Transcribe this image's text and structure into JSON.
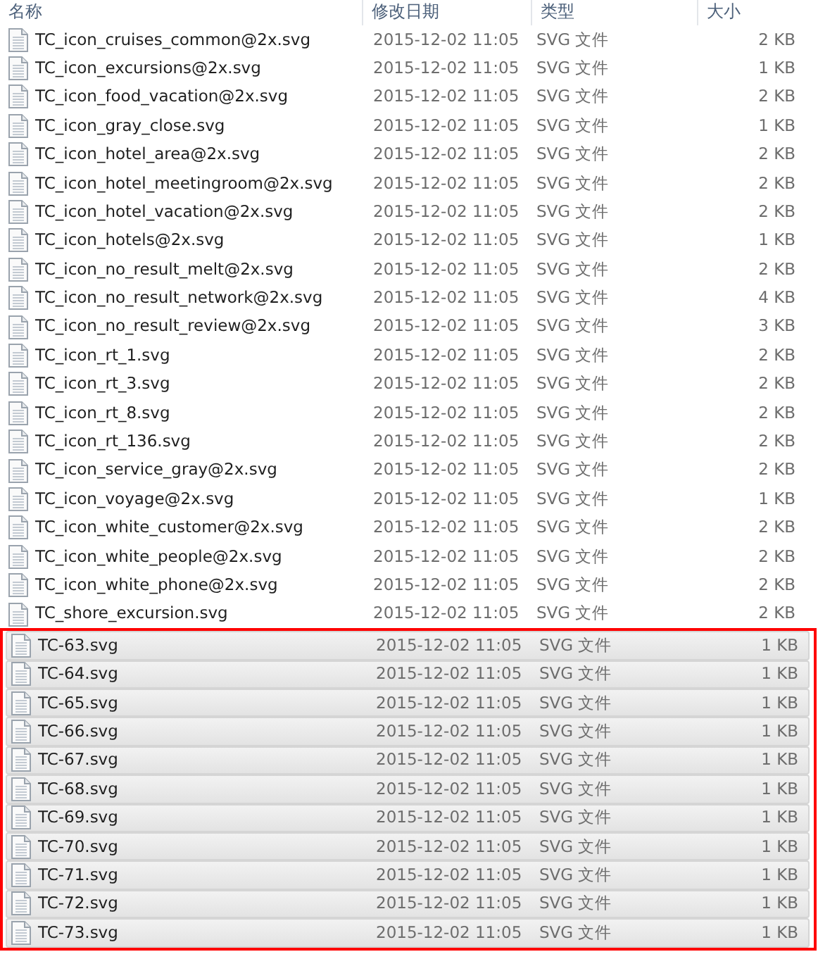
{
  "columns": [
    "名称",
    "修改日期",
    "类型",
    "大小"
  ],
  "files": [
    {
      "name": "TC_icon_cruises_common@2x.svg",
      "modified": "2015-12-02 11:05",
      "type": "SVG 文件",
      "size": "2 KB",
      "selected": false
    },
    {
      "name": "TC_icon_excursions@2x.svg",
      "modified": "2015-12-02 11:05",
      "type": "SVG 文件",
      "size": "1 KB",
      "selected": false
    },
    {
      "name": "TC_icon_food_vacation@2x.svg",
      "modified": "2015-12-02 11:05",
      "type": "SVG 文件",
      "size": "2 KB",
      "selected": false
    },
    {
      "name": "TC_icon_gray_close.svg",
      "modified": "2015-12-02 11:05",
      "type": "SVG 文件",
      "size": "1 KB",
      "selected": false
    },
    {
      "name": "TC_icon_hotel_area@2x.svg",
      "modified": "2015-12-02 11:05",
      "type": "SVG 文件",
      "size": "2 KB",
      "selected": false
    },
    {
      "name": "TC_icon_hotel_meetingroom@2x.svg",
      "modified": "2015-12-02 11:05",
      "type": "SVG 文件",
      "size": "2 KB",
      "selected": false
    },
    {
      "name": "TC_icon_hotel_vacation@2x.svg",
      "modified": "2015-12-02 11:05",
      "type": "SVG 文件",
      "size": "2 KB",
      "selected": false
    },
    {
      "name": "TC_icon_hotels@2x.svg",
      "modified": "2015-12-02 11:05",
      "type": "SVG 文件",
      "size": "1 KB",
      "selected": false
    },
    {
      "name": "TC_icon_no_result_melt@2x.svg",
      "modified": "2015-12-02 11:05",
      "type": "SVG 文件",
      "size": "2 KB",
      "selected": false
    },
    {
      "name": "TC_icon_no_result_network@2x.svg",
      "modified": "2015-12-02 11:05",
      "type": "SVG 文件",
      "size": "4 KB",
      "selected": false
    },
    {
      "name": "TC_icon_no_result_review@2x.svg",
      "modified": "2015-12-02 11:05",
      "type": "SVG 文件",
      "size": "3 KB",
      "selected": false
    },
    {
      "name": "TC_icon_rt_1.svg",
      "modified": "2015-12-02 11:05",
      "type": "SVG 文件",
      "size": "2 KB",
      "selected": false
    },
    {
      "name": "TC_icon_rt_3.svg",
      "modified": "2015-12-02 11:05",
      "type": "SVG 文件",
      "size": "2 KB",
      "selected": false
    },
    {
      "name": "TC_icon_rt_8.svg",
      "modified": "2015-12-02 11:05",
      "type": "SVG 文件",
      "size": "2 KB",
      "selected": false
    },
    {
      "name": "TC_icon_rt_136.svg",
      "modified": "2015-12-02 11:05",
      "type": "SVG 文件",
      "size": "2 KB",
      "selected": false
    },
    {
      "name": "TC_icon_service_gray@2x.svg",
      "modified": "2015-12-02 11:05",
      "type": "SVG 文件",
      "size": "2 KB",
      "selected": false
    },
    {
      "name": "TC_icon_voyage@2x.svg",
      "modified": "2015-12-02 11:05",
      "type": "SVG 文件",
      "size": "1 KB",
      "selected": false
    },
    {
      "name": "TC_icon_white_customer@2x.svg",
      "modified": "2015-12-02 11:05",
      "type": "SVG 文件",
      "size": "2 KB",
      "selected": false
    },
    {
      "name": "TC_icon_white_people@2x.svg",
      "modified": "2015-12-02 11:05",
      "type": "SVG 文件",
      "size": "2 KB",
      "selected": false
    },
    {
      "name": "TC_icon_white_phone@2x.svg",
      "modified": "2015-12-02 11:05",
      "type": "SVG 文件",
      "size": "2 KB",
      "selected": false
    },
    {
      "name": "TC_shore_excursion.svg",
      "modified": "2015-12-02 11:05",
      "type": "SVG 文件",
      "size": "2 KB",
      "selected": false
    },
    {
      "name": "TC-63.svg",
      "modified": "2015-12-02 11:05",
      "type": "SVG 文件",
      "size": "1 KB",
      "selected": true
    },
    {
      "name": "TC-64.svg",
      "modified": "2015-12-02 11:05",
      "type": "SVG 文件",
      "size": "1 KB",
      "selected": true
    },
    {
      "name": "TC-65.svg",
      "modified": "2015-12-02 11:05",
      "type": "SVG 文件",
      "size": "1 KB",
      "selected": true
    },
    {
      "name": "TC-66.svg",
      "modified": "2015-12-02 11:05",
      "type": "SVG 文件",
      "size": "1 KB",
      "selected": true
    },
    {
      "name": "TC-67.svg",
      "modified": "2015-12-02 11:05",
      "type": "SVG 文件",
      "size": "1 KB",
      "selected": true
    },
    {
      "name": "TC-68.svg",
      "modified": "2015-12-02 11:05",
      "type": "SVG 文件",
      "size": "1 KB",
      "selected": true
    },
    {
      "name": "TC-69.svg",
      "modified": "2015-12-02 11:05",
      "type": "SVG 文件",
      "size": "1 KB",
      "selected": true
    },
    {
      "name": "TC-70.svg",
      "modified": "2015-12-02 11:05",
      "type": "SVG 文件",
      "size": "1 KB",
      "selected": true
    },
    {
      "name": "TC-71.svg",
      "modified": "2015-12-02 11:05",
      "type": "SVG 文件",
      "size": "1 KB",
      "selected": true
    },
    {
      "name": "TC-72.svg",
      "modified": "2015-12-02 11:05",
      "type": "SVG 文件",
      "size": "1 KB",
      "selected": true
    },
    {
      "name": "TC-73.svg",
      "modified": "2015-12-02 11:05",
      "type": "SVG 文件",
      "size": "1 KB",
      "selected": true
    }
  ]
}
